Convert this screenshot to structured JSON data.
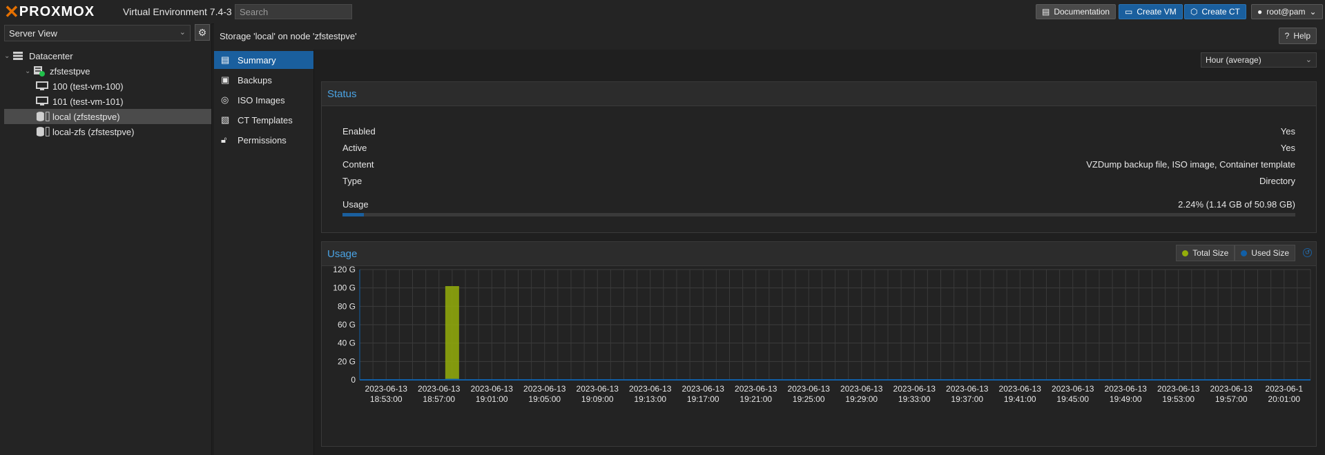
{
  "app": {
    "logo_text": "PROXMOX",
    "version": "Virtual Environment 7.4-3",
    "search_placeholder": "Search"
  },
  "toolbar": {
    "documentation": "Documentation",
    "create_vm": "Create VM",
    "create_ct": "Create CT",
    "user": "root@pam"
  },
  "left": {
    "view": "Server View",
    "tree": [
      {
        "label": "Datacenter",
        "icon": "datacenter-icon"
      },
      {
        "label": "zfstestpve",
        "icon": "node-online-icon"
      },
      {
        "label": "100 (test-vm-100)",
        "icon": "vm-icon"
      },
      {
        "label": "101 (test-vm-101)",
        "icon": "vm-icon"
      },
      {
        "label": "local (zfstestpve)",
        "icon": "storage-icon"
      },
      {
        "label": "local-zfs (zfstestpve)",
        "icon": "storage-icon"
      }
    ]
  },
  "header": {
    "title": "Storage 'local' on node 'zfstestpve'",
    "help": "Help"
  },
  "nav": [
    {
      "label": "Summary",
      "icon": "book-icon"
    },
    {
      "label": "Backups",
      "icon": "floppy-icon"
    },
    {
      "label": "ISO Images",
      "icon": "disc-icon"
    },
    {
      "label": "CT Templates",
      "icon": "template-icon"
    },
    {
      "label": "Permissions",
      "icon": "unlock-icon"
    }
  ],
  "timeframe": "Hour (average)",
  "status": {
    "title": "Status",
    "rows": [
      {
        "key": "Enabled",
        "value": "Yes"
      },
      {
        "key": "Active",
        "value": "Yes"
      },
      {
        "key": "Content",
        "value": "VZDump backup file, ISO image, Container template"
      },
      {
        "key": "Type",
        "value": "Directory"
      }
    ],
    "usage_label": "Usage",
    "usage_value": "2.24% (1.14 GB of 50.98 GB)",
    "usage_fraction": 0.0224
  },
  "usage_chart": {
    "title": "Usage",
    "legend": [
      {
        "label": "Total Size",
        "color": "#94ae0a"
      },
      {
        "label": "Used Size",
        "color": "#115fa6"
      }
    ]
  },
  "colors": {
    "accent": "#1a5f9e",
    "title_blue": "#4aa3e4",
    "brand_orange": "#e57000",
    "total_size": "#94ae0a",
    "used_size": "#115fa6"
  },
  "chart_data": {
    "type": "bar",
    "title": "Usage",
    "ylim": [
      0,
      120
    ],
    "yticks": [
      "0",
      "20 G",
      "40 G",
      "60 G",
      "80 G",
      "100 G",
      "120 G"
    ],
    "xticks": [
      [
        "2023-06-13",
        "18:53:00"
      ],
      [
        "2023-06-13",
        "18:57:00"
      ],
      [
        "2023-06-13",
        "19:01:00"
      ],
      [
        "2023-06-13",
        "19:05:00"
      ],
      [
        "2023-06-13",
        "19:09:00"
      ],
      [
        "2023-06-13",
        "19:13:00"
      ],
      [
        "2023-06-13",
        "19:17:00"
      ],
      [
        "2023-06-13",
        "19:21:00"
      ],
      [
        "2023-06-13",
        "19:25:00"
      ],
      [
        "2023-06-13",
        "19:29:00"
      ],
      [
        "2023-06-13",
        "19:33:00"
      ],
      [
        "2023-06-13",
        "19:37:00"
      ],
      [
        "2023-06-13",
        "19:41:00"
      ],
      [
        "2023-06-13",
        "19:45:00"
      ],
      [
        "2023-06-13",
        "19:49:00"
      ],
      [
        "2023-06-13",
        "19:53:00"
      ],
      [
        "2023-06-13",
        "19:57:00"
      ],
      [
        "2023-06-1",
        "20:01:00"
      ]
    ],
    "series": [
      {
        "name": "Total Size",
        "points": [
          {
            "x": "2023-06-13 18:58:00",
            "y": 102
          }
        ]
      },
      {
        "name": "Used Size",
        "points": [
          {
            "x": "2023-06-13 18:58:00",
            "y": 1.14
          }
        ]
      }
    ],
    "grid": true,
    "legend_position": "top-right"
  }
}
